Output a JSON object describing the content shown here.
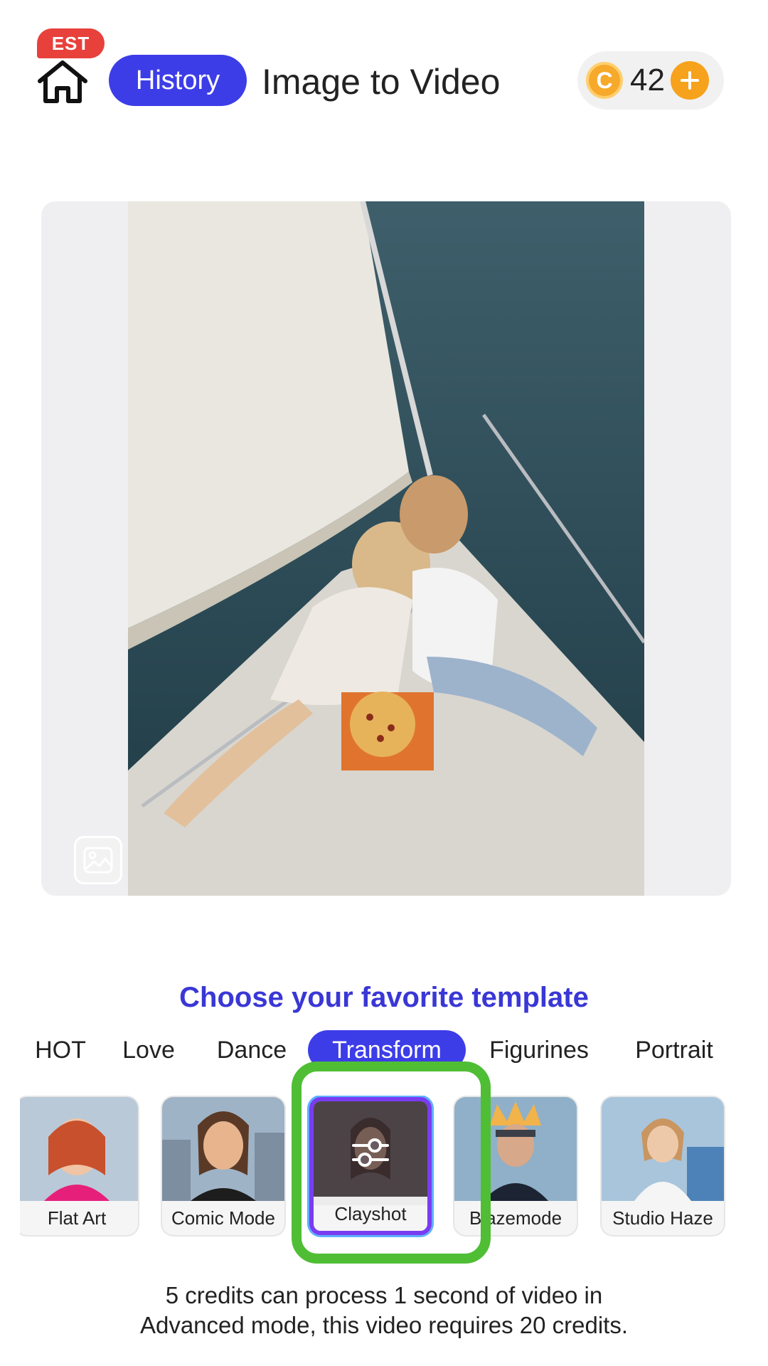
{
  "header": {
    "badge": "EST",
    "history_label": "History",
    "title": "Image to Video",
    "credits": "42",
    "coin_symbol": "C"
  },
  "preview": {
    "replace_icon": "image-icon"
  },
  "templates": {
    "heading": "Choose your favorite template",
    "tabs": [
      "HOT",
      "Love",
      "Dance",
      "Transform",
      "Figurines",
      "Portrait"
    ],
    "active_tab": "Transform",
    "cards": [
      {
        "label": "Flat Art"
      },
      {
        "label": "Comic Mode"
      },
      {
        "label": "Clayshot",
        "selected": true
      },
      {
        "label": "Blazemode"
      },
      {
        "label": "Studio Haze"
      }
    ]
  },
  "info": {
    "line1": "5 credits can process 1 second of video in",
    "line2": "Advanced mode, this video requires 20 credits."
  },
  "colors": {
    "accent": "#3d3de8",
    "heading": "#3a37d6",
    "coin": "#f6a92a",
    "highlight": "#4fbe35"
  }
}
